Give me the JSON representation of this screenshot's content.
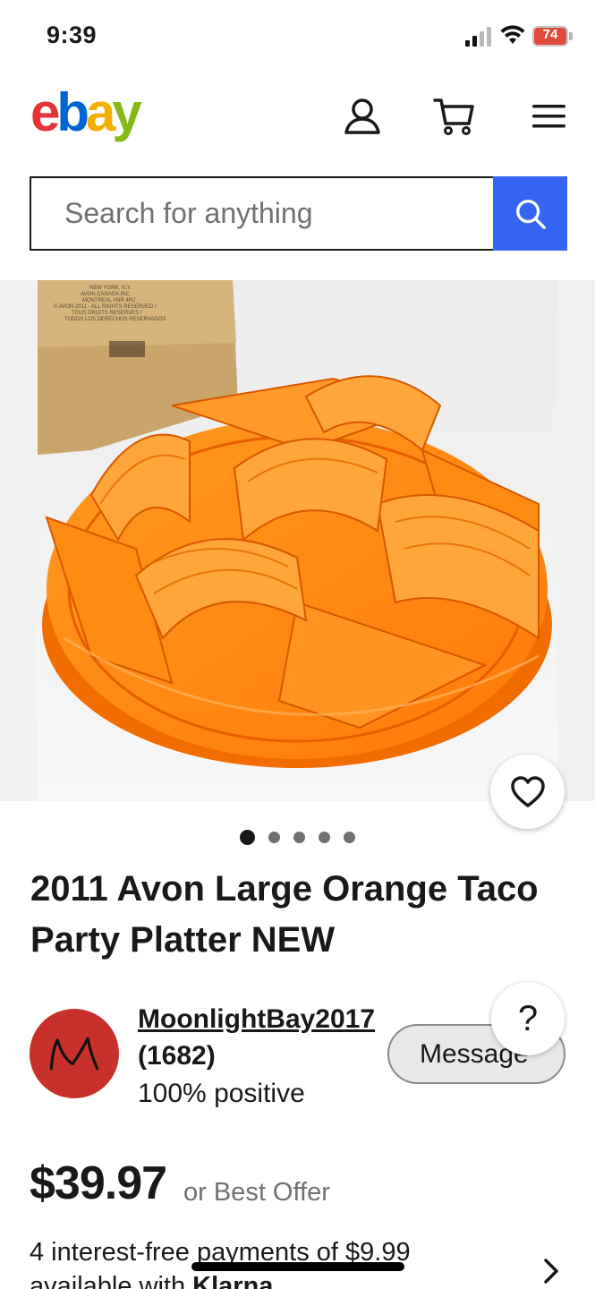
{
  "status_bar": {
    "time": "9:39",
    "battery": "74"
  },
  "header": {
    "logo_letters": [
      "e",
      "b",
      "a",
      "y"
    ],
    "icons": [
      "user-icon",
      "cart-icon",
      "menu-icon"
    ]
  },
  "search": {
    "placeholder": "Search for anything"
  },
  "gallery": {
    "image_count": 5,
    "active_index": 0
  },
  "item": {
    "title": "2011 Avon Large Orange Taco Party Platter NEW",
    "box_text": [
      "NEW YORK, N.Y.",
      "AVON CANADA INC",
      "MONTREAL H9R 4R2",
      "© AVON 2011 - ALL RIGHTS RESERVED /",
      "TOUS DROITS RESERVES /",
      "TODOS LOS DERECHOS RESERVADOS"
    ]
  },
  "seller": {
    "avatar_letter": "M",
    "name": "MoonlightBay2017",
    "feedback_count": "(1682)",
    "positive": "100% positive",
    "message_label": "Message",
    "help_label": "?"
  },
  "pricing": {
    "price": "$39.97",
    "best_offer": "or Best Offer",
    "installments": "4 interest-free payments of $9.99",
    "available_with": "available with",
    "brand": "Klarna"
  },
  "colors": {
    "ebay_red": "#e53238",
    "ebay_blue": "#0064d2",
    "ebay_yellow": "#f5af02",
    "ebay_green": "#86b817",
    "search_blue": "#3665f3",
    "avatar_red": "#c8302b"
  }
}
